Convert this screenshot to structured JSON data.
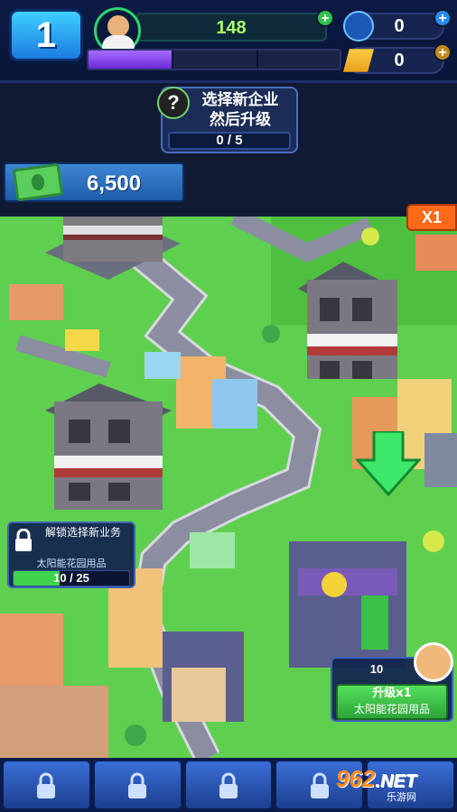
{
  "level": "1",
  "population": "148",
  "gems": "0",
  "gold": "0",
  "xp_progress": 0.33,
  "mission": {
    "text": "选择新企业\n然后升级",
    "progress": "0 / 5"
  },
  "money": "6,500",
  "speed": "X1",
  "locked_business": {
    "title": "解锁选择新业务",
    "name": "太阳能花园用品",
    "progress_text": "10 / 25",
    "progress": 0.4
  },
  "upgrade": {
    "count": "10",
    "label": "升级x1",
    "business": "太阳能花园用品"
  },
  "watermark": {
    "brand": "962",
    "suffix": ".NET",
    "site": "乐游网"
  },
  "colors": {
    "grass": "#5fcf4f",
    "accent_orange": "#ff6a1a",
    "panel_blue": "#1c3f8f",
    "xp_purple": "#8a4ae8"
  }
}
